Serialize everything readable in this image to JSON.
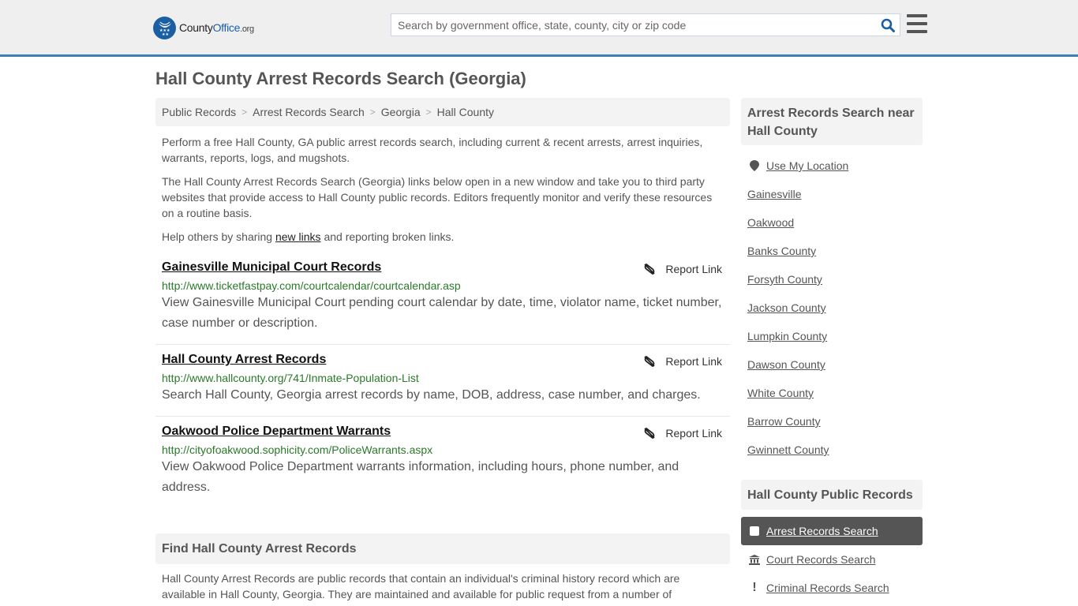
{
  "header": {
    "logo": {
      "name_part1": "County",
      "name_part2": "Office",
      "name_part3": ".org"
    },
    "search": {
      "placeholder": "Search by government office, state, county, city or zip code",
      "value": ""
    },
    "brand_color": "#1b5fa3",
    "accent_border_color": "#3c7fb0"
  },
  "page": {
    "title": "Hall County Arrest Records Search (Georgia)"
  },
  "breadcrumb": [
    {
      "label": "Public Records"
    },
    {
      "label": "Arrest Records Search"
    },
    {
      "label": "Georgia"
    },
    {
      "label": "Hall County"
    }
  ],
  "breadcrumb_separator": ">",
  "intro": {
    "p1": "Perform a free Hall County, GA public arrest records search, including current & recent arrests, arrest inquiries, warrants, reports, logs, and mugshots.",
    "p2": "The Hall County Arrest Records Search (Georgia) links below open in a new window and take you to third party websites that provide access to Hall County public records. Editors frequently monitor and verify these resources on a routine basis.",
    "p3_before": "Help others by sharing ",
    "p3_link": "new links",
    "p3_after": " and reporting broken links."
  },
  "results": [
    {
      "title": "Gainesville Municipal Court Records",
      "url": "http://www.ticketfastpay.com/courtcalendar/courtcalendar.asp",
      "description": "View Gainesville Municipal Court pending court calendar by date, time, violator name, ticket number, case number or description.",
      "report_label": "Report Link"
    },
    {
      "title": "Hall County Arrest Records",
      "url": "http://www.hallcounty.org/741/Inmate-Population-List",
      "description": "Search Hall County, Georgia arrest records by name, DOB, address, case number, and charges.",
      "report_label": "Report Link"
    },
    {
      "title": "Oakwood Police Department Warrants",
      "url": "http://cityofoakwood.sophicity.com/PoliceWarrants.aspx",
      "description": "View Oakwood Police Department warrants information, including hours, phone number, and address.",
      "report_label": "Report Link"
    }
  ],
  "find_section": {
    "heading": "Find Hall County Arrest Records",
    "body": "Hall County Arrest Records are public records that contain an individual's criminal history record which are available in Hall County, Georgia. They are maintained and available for public request from a number of"
  },
  "sidebar": {
    "nearby_heading": "Arrest Records Search near Hall County",
    "use_location": "Use My Location",
    "nearby": [
      "Gainesville",
      "Oakwood",
      "Banks County",
      "Forsyth County",
      "Jackson County",
      "Lumpkin County",
      "Dawson County",
      "White County",
      "Barrow County",
      "Gwinnett County"
    ],
    "records_heading": "Hall County Public Records",
    "records": [
      {
        "label": "Arrest Records Search",
        "icon": "square-icon",
        "active": true
      },
      {
        "label": "Court Records Search",
        "icon": "courthouse-icon",
        "active": false
      },
      {
        "label": "Criminal Records Search",
        "icon": "exclamation-icon",
        "active": false
      }
    ]
  }
}
